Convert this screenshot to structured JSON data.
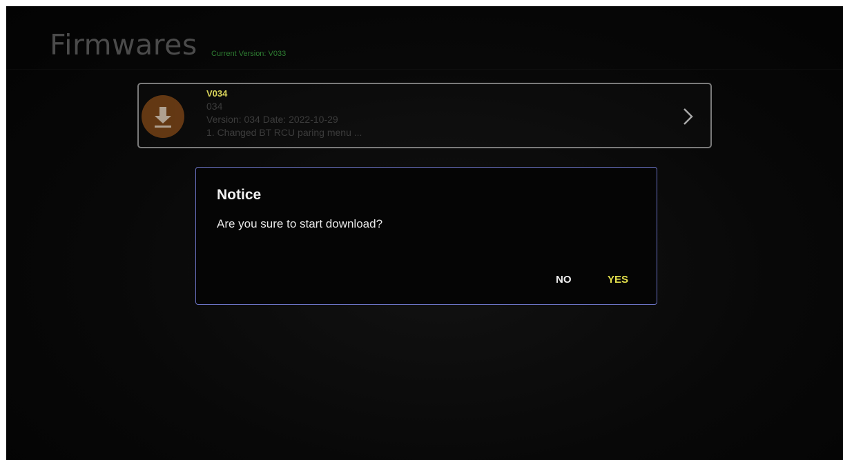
{
  "header": {
    "title": "Firmwares",
    "current_version": "Current Version: V033"
  },
  "firmware_item": {
    "name": "V034",
    "code": "034",
    "version_date": "Version: 034 Date: 2022-10-29",
    "changelog": "1. Changed BT RCU paring menu ...",
    "icon": "download-icon",
    "chevron": "chevron-right-icon"
  },
  "dialog": {
    "title": "Notice",
    "message": "Are you sure to start download?",
    "no_label": "NO",
    "yes_label": "YES"
  },
  "colors": {
    "accent_yellow": "#e3e04c",
    "current_version_green": "#2e7d32",
    "dialog_border": "#6b73c4",
    "download_icon_bg": "#7a4416"
  }
}
